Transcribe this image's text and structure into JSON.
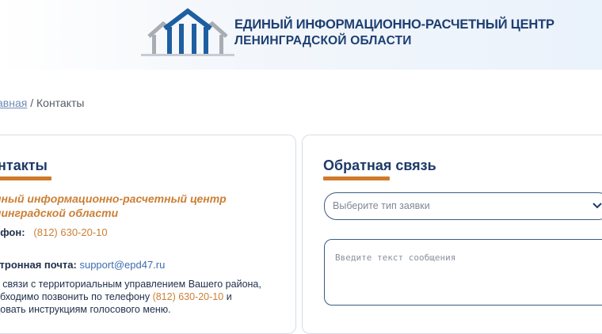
{
  "header": {
    "logo_line1": "ЕДИНЫЙ ИНФОРМАЦИОННО-РАСЧЕТНЫЙ ЦЕНТР",
    "logo_line2": "ЛЕНИНГРАДСКОЙ ОБЛАСТИ"
  },
  "breadcrumb": {
    "home": "авная",
    "separator": " / ",
    "current": "Контакты"
  },
  "contacts": {
    "title": "нтакты",
    "org_line1": "иный информационно-расчетный центр",
    "org_line2": "нинградской области",
    "phone_label": "ефон:",
    "phone_value": "(812) 630-20-10",
    "email_label": "ктронная почта:",
    "email_value": "support@epd47.ru",
    "note_line1": "я связи с территориальным управлением Вашего района,",
    "note_line2_a": "обходимо позвонить по телефону ",
    "note_line2_phone": "(812) 630-20-10",
    "note_line2_b": " и",
    "note_line3": "довать инструкциям голосового меню."
  },
  "feedback": {
    "title": "Обратная связь",
    "select_placeholder": "Выберите тип заявки",
    "textarea_placeholder": "Введите текст сообщения"
  },
  "colors": {
    "accent_orange": "#cf7a2c",
    "brand_navy": "#1d3a68",
    "link_blue": "#3d6db0"
  },
  "icons": {
    "logo": "house-logo-icon",
    "select_arrow": "chevron-down-icon"
  }
}
